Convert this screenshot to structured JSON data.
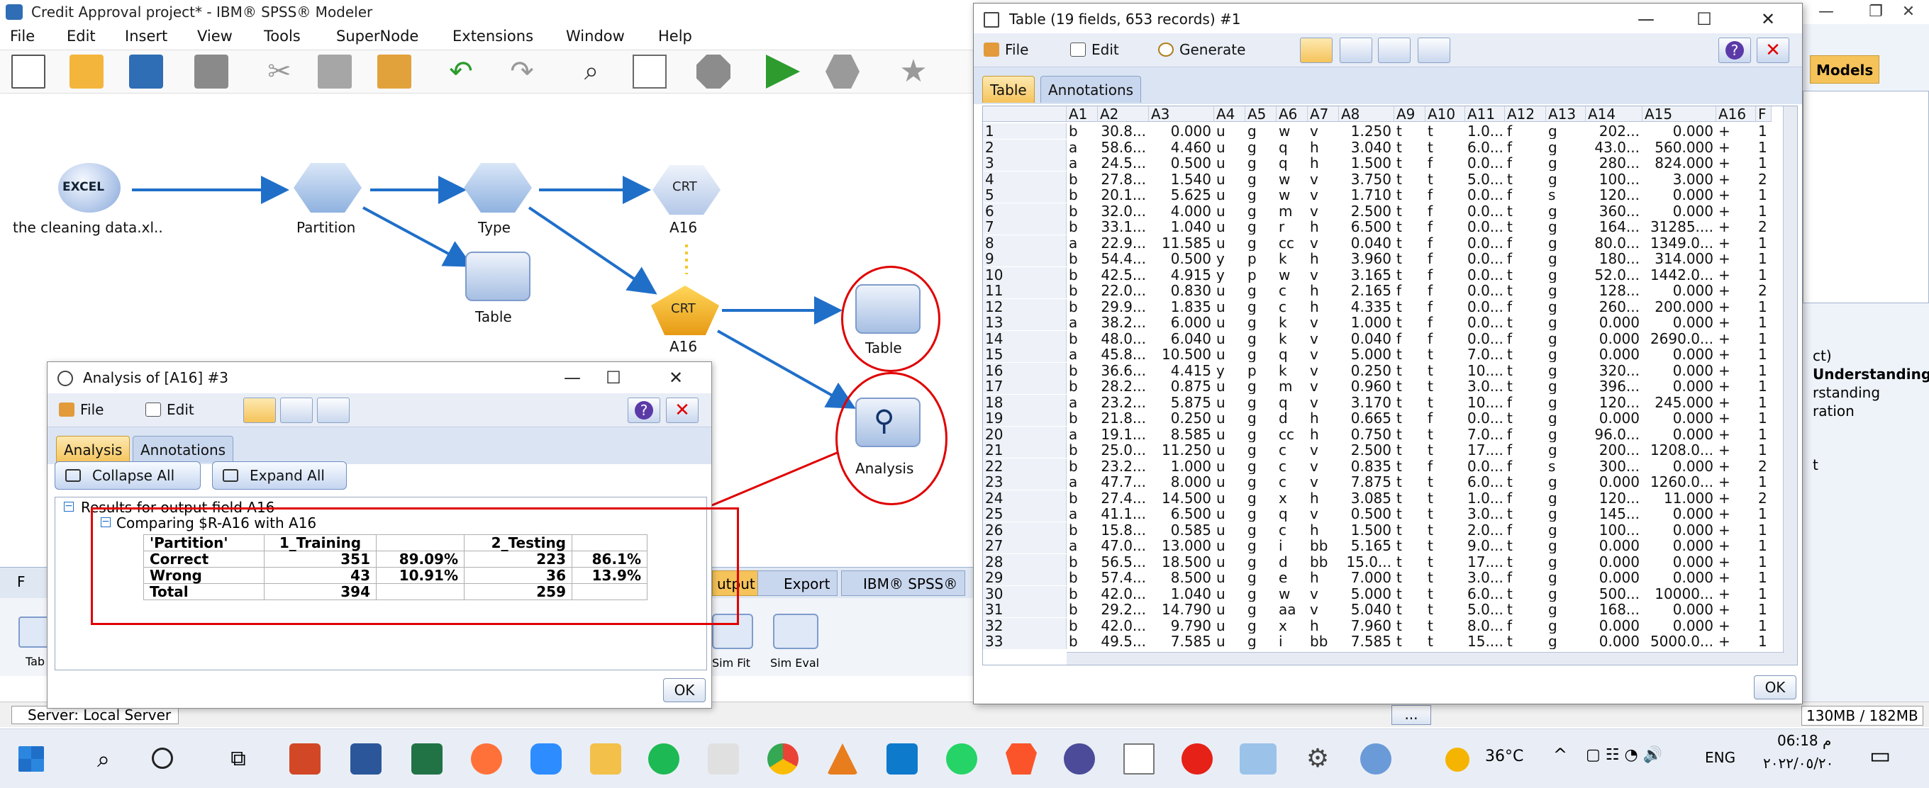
{
  "main_window": {
    "title": "Credit Approval project* - IBM® SPSS® Modeler",
    "menu": [
      "File",
      "Edit",
      "Insert",
      "View",
      "Tools",
      "SuperNode",
      "Extensions",
      "Window",
      "Help"
    ]
  },
  "stream": {
    "nodes": {
      "excel": "the cleaning data.xl..",
      "partition": "Partition",
      "type": "Type",
      "model": "A16",
      "table1": "Table",
      "applied_model": "A16",
      "table2": "Table",
      "analysis": "Analysis"
    },
    "excel_icon_text": "EXCEL",
    "crt_text": "CRT"
  },
  "palette": {
    "tabs": [
      "F",
      "utput",
      "Export",
      "IBM® SPSS®"
    ],
    "items": [
      "Tab",
      "Sim Fit",
      "Sim Eval"
    ]
  },
  "analysis_window": {
    "title": "Analysis of [A16] #3",
    "menu": [
      "File",
      "Edit"
    ],
    "tabs": [
      "Analysis",
      "Annotations"
    ],
    "collapse_all": "Collapse All",
    "expand_all": "Expand All",
    "tree_root": "Results for output field A16",
    "tree_child": "Comparing $R-A16 with A16",
    "table": {
      "header": [
        "'Partition'",
        "1_Training",
        "",
        "2_Testing",
        ""
      ],
      "rows": [
        [
          "Correct",
          "351",
          "89.09%",
          "223",
          "86.1%"
        ],
        [
          "Wrong",
          "43",
          "10.91%",
          "36",
          "13.9%"
        ],
        [
          "Total",
          "394",
          "",
          "259",
          ""
        ]
      ]
    },
    "ok": "OK"
  },
  "table_window": {
    "title": "Table (19 fields, 653 records) #1",
    "menu": [
      "File",
      "Edit",
      "Generate"
    ],
    "tabs": [
      "Table",
      "Annotations"
    ],
    "columns": [
      "",
      "A1",
      "A2",
      "A3",
      "A4",
      "A5",
      "A6",
      "A7",
      "A8",
      "A9",
      "A10",
      "A11",
      "A12",
      "A13",
      "A14",
      "A15",
      "A16",
      "F"
    ],
    "rows": [
      [
        "1",
        "b",
        "30.8...",
        "0.000",
        "u",
        "g",
        "w",
        "v",
        "1.250",
        "t",
        "t",
        "1.0...",
        "f",
        "g",
        "202...",
        "0.000",
        "+",
        "1"
      ],
      [
        "2",
        "a",
        "58.6...",
        "4.460",
        "u",
        "g",
        "q",
        "h",
        "3.040",
        "t",
        "t",
        "6.0...",
        "f",
        "g",
        "43.0...",
        "560.000",
        "+",
        "1"
      ],
      [
        "3",
        "a",
        "24.5...",
        "0.500",
        "u",
        "g",
        "q",
        "h",
        "1.500",
        "t",
        "f",
        "0.0...",
        "f",
        "g",
        "280...",
        "824.000",
        "+",
        "1"
      ],
      [
        "4",
        "b",
        "27.8...",
        "1.540",
        "u",
        "g",
        "w",
        "v",
        "3.750",
        "t",
        "t",
        "5.0...",
        "t",
        "g",
        "100...",
        "3.000",
        "+",
        "2"
      ],
      [
        "5",
        "b",
        "20.1...",
        "5.625",
        "u",
        "g",
        "w",
        "v",
        "1.710",
        "t",
        "f",
        "0.0...",
        "f",
        "s",
        "120...",
        "0.000",
        "+",
        "1"
      ],
      [
        "6",
        "b",
        "32.0...",
        "4.000",
        "u",
        "g",
        "m",
        "v",
        "2.500",
        "t",
        "f",
        "0.0...",
        "t",
        "g",
        "360...",
        "0.000",
        "+",
        "1"
      ],
      [
        "7",
        "b",
        "33.1...",
        "1.040",
        "u",
        "g",
        "r",
        "h",
        "6.500",
        "t",
        "f",
        "0.0...",
        "t",
        "g",
        "164...",
        "31285....",
        "+",
        "2"
      ],
      [
        "8",
        "a",
        "22.9...",
        "11.585",
        "u",
        "g",
        "cc",
        "v",
        "0.040",
        "t",
        "f",
        "0.0...",
        "f",
        "g",
        "80.0...",
        "1349.0...",
        "+",
        "1"
      ],
      [
        "9",
        "b",
        "54.4...",
        "0.500",
        "y",
        "p",
        "k",
        "h",
        "3.960",
        "t",
        "f",
        "0.0...",
        "f",
        "g",
        "180...",
        "314.000",
        "+",
        "1"
      ],
      [
        "10",
        "b",
        "42.5...",
        "4.915",
        "y",
        "p",
        "w",
        "v",
        "3.165",
        "t",
        "f",
        "0.0...",
        "t",
        "g",
        "52.0...",
        "1442.0...",
        "+",
        "1"
      ],
      [
        "11",
        "b",
        "22.0...",
        "0.830",
        "u",
        "g",
        "c",
        "h",
        "2.165",
        "f",
        "f",
        "0.0...",
        "t",
        "g",
        "128...",
        "0.000",
        "+",
        "2"
      ],
      [
        "12",
        "b",
        "29.9...",
        "1.835",
        "u",
        "g",
        "c",
        "h",
        "4.335",
        "t",
        "f",
        "0.0...",
        "f",
        "g",
        "260...",
        "200.000",
        "+",
        "1"
      ],
      [
        "13",
        "a",
        "38.2...",
        "6.000",
        "u",
        "g",
        "k",
        "v",
        "1.000",
        "t",
        "f",
        "0.0...",
        "t",
        "g",
        "0.000",
        "0.000",
        "+",
        "1"
      ],
      [
        "14",
        "b",
        "48.0...",
        "6.040",
        "u",
        "g",
        "k",
        "v",
        "0.040",
        "f",
        "f",
        "0.0...",
        "f",
        "g",
        "0.000",
        "2690.0...",
        "+",
        "1"
      ],
      [
        "15",
        "a",
        "45.8...",
        "10.500",
        "u",
        "g",
        "q",
        "v",
        "5.000",
        "t",
        "t",
        "7.0...",
        "t",
        "g",
        "0.000",
        "0.000",
        "+",
        "1"
      ],
      [
        "16",
        "b",
        "36.6...",
        "4.415",
        "y",
        "p",
        "k",
        "v",
        "0.250",
        "t",
        "t",
        "10....",
        "t",
        "g",
        "320...",
        "0.000",
        "+",
        "1"
      ],
      [
        "17",
        "b",
        "28.2...",
        "0.875",
        "u",
        "g",
        "m",
        "v",
        "0.960",
        "t",
        "t",
        "3.0...",
        "t",
        "g",
        "396...",
        "0.000",
        "+",
        "1"
      ],
      [
        "18",
        "a",
        "23.2...",
        "5.875",
        "u",
        "g",
        "q",
        "v",
        "3.170",
        "t",
        "t",
        "10....",
        "f",
        "g",
        "120...",
        "245.000",
        "+",
        "1"
      ],
      [
        "19",
        "b",
        "21.8...",
        "0.250",
        "u",
        "g",
        "d",
        "h",
        "0.665",
        "t",
        "f",
        "0.0...",
        "t",
        "g",
        "0.000",
        "0.000",
        "+",
        "1"
      ],
      [
        "20",
        "a",
        "19.1...",
        "8.585",
        "u",
        "g",
        "cc",
        "h",
        "0.750",
        "t",
        "t",
        "7.0...",
        "f",
        "g",
        "96.0...",
        "0.000",
        "+",
        "1"
      ],
      [
        "21",
        "b",
        "25.0...",
        "11.250",
        "u",
        "g",
        "c",
        "v",
        "2.500",
        "t",
        "t",
        "17....",
        "f",
        "g",
        "200...",
        "1208.0...",
        "+",
        "1"
      ],
      [
        "22",
        "b",
        "23.2...",
        "1.000",
        "u",
        "g",
        "c",
        "v",
        "0.835",
        "t",
        "f",
        "0.0...",
        "f",
        "s",
        "300...",
        "0.000",
        "+",
        "2"
      ],
      [
        "23",
        "a",
        "47.7...",
        "8.000",
        "u",
        "g",
        "c",
        "v",
        "7.875",
        "t",
        "t",
        "6.0...",
        "t",
        "g",
        "0.000",
        "1260.0...",
        "+",
        "1"
      ],
      [
        "24",
        "b",
        "27.4...",
        "14.500",
        "u",
        "g",
        "x",
        "h",
        "3.085",
        "t",
        "t",
        "1.0...",
        "f",
        "g",
        "120...",
        "11.000",
        "+",
        "2"
      ],
      [
        "25",
        "a",
        "41.1...",
        "6.500",
        "u",
        "g",
        "q",
        "v",
        "0.500",
        "t",
        "t",
        "3.0...",
        "t",
        "g",
        "145...",
        "0.000",
        "+",
        "1"
      ],
      [
        "26",
        "b",
        "15.8...",
        "0.585",
        "u",
        "g",
        "c",
        "h",
        "1.500",
        "t",
        "t",
        "2.0...",
        "f",
        "g",
        "100...",
        "0.000",
        "+",
        "1"
      ],
      [
        "27",
        "a",
        "47.0...",
        "13.000",
        "u",
        "g",
        "i",
        "bb",
        "5.165",
        "t",
        "t",
        "9.0...",
        "t",
        "g",
        "0.000",
        "0.000",
        "+",
        "1"
      ],
      [
        "28",
        "b",
        "56.5...",
        "18.500",
        "u",
        "g",
        "d",
        "bb",
        "15.0...",
        "t",
        "t",
        "17....",
        "t",
        "g",
        "0.000",
        "0.000",
        "+",
        "1"
      ],
      [
        "29",
        "b",
        "57.4...",
        "8.500",
        "u",
        "g",
        "e",
        "h",
        "7.000",
        "t",
        "t",
        "3.0...",
        "f",
        "g",
        "0.000",
        "0.000",
        "+",
        "1"
      ],
      [
        "30",
        "b",
        "42.0...",
        "1.040",
        "u",
        "g",
        "w",
        "v",
        "5.000",
        "t",
        "t",
        "6.0...",
        "t",
        "g",
        "500...",
        "10000...",
        "+",
        "1"
      ],
      [
        "31",
        "b",
        "29.2...",
        "14.790",
        "u",
        "g",
        "aa",
        "v",
        "5.040",
        "t",
        "t",
        "5.0...",
        "t",
        "g",
        "168...",
        "0.000",
        "+",
        "1"
      ],
      [
        "32",
        "b",
        "42.0...",
        "9.790",
        "u",
        "g",
        "x",
        "h",
        "7.960",
        "t",
        "t",
        "8.0...",
        "f",
        "g",
        "0.000",
        "0.000",
        "+",
        "1"
      ],
      [
        "33",
        "b",
        "49.5...",
        "7.585",
        "u",
        "g",
        "i",
        "bb",
        "7.585",
        "t",
        "t",
        "15....",
        "t",
        "g",
        "0.000",
        "5000.0...",
        "+",
        "1"
      ]
    ],
    "ok": "OK"
  },
  "right_panel": {
    "models_tab": "Models",
    "lines": [
      "ct)",
      "Understanding",
      "rstanding",
      "ration",
      "t"
    ],
    "memory": "130MB / 182MB"
  },
  "status": {
    "server": "Server: Local Server",
    "dots": "..."
  },
  "taskbar": {
    "temperature": "36°C",
    "language": "ENG",
    "time": "06:18 م",
    "date": "٢٠٢٢/٠٥/٢٠"
  },
  "colors": {
    "accent_red": "#e00000",
    "tab_active": "#f5c35a",
    "link_blue": "#1f6fc9"
  }
}
